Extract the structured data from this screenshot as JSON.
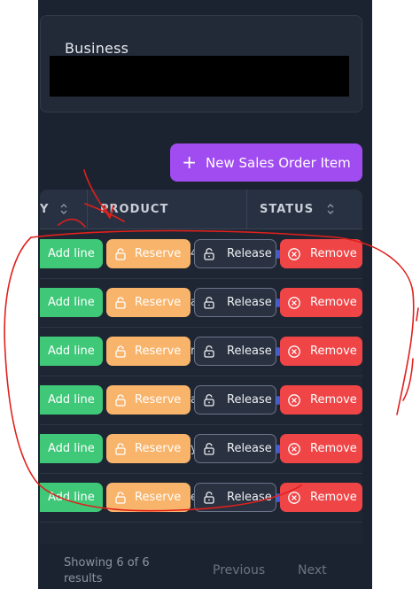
{
  "business": {
    "label": "Business"
  },
  "toolbar": {
    "new_button_label": "New Sales Order Item",
    "accent_color": "#a14cf0"
  },
  "table": {
    "columns": [
      {
        "label": "Y"
      },
      {
        "label": "PRODUCT"
      },
      {
        "label": "STATUS"
      }
    ],
    "actions": {
      "add_line": "Add line",
      "reserve": "Reserve",
      "release": "Release",
      "remove": "Remove"
    },
    "colors": {
      "add_line": "#3ec878",
      "reserve": "#f8b46b",
      "release": "#2a3241",
      "remove": "#ef4546"
    },
    "row_count": 6,
    "partial_text": [
      "4",
      "a",
      "r",
      "a",
      "y",
      "e"
    ]
  },
  "footer": {
    "showing_text": "Showing 6 of 6 results",
    "previous_label": "Previous",
    "next_label": "Next"
  },
  "annotations": {
    "color": "#e0201c"
  }
}
